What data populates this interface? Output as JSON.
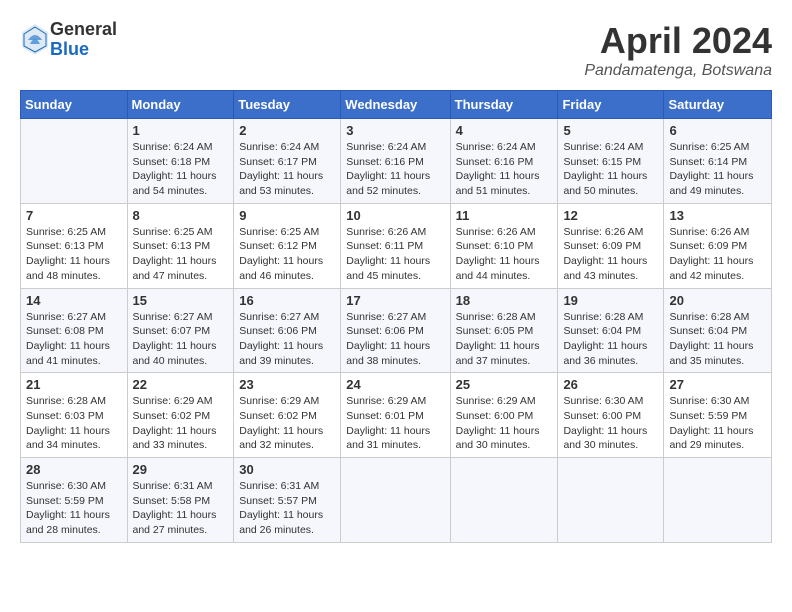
{
  "logo": {
    "general": "General",
    "blue": "Blue"
  },
  "title": "April 2024",
  "location": "Pandamatenga, Botswana",
  "days_header": [
    "Sunday",
    "Monday",
    "Tuesday",
    "Wednesday",
    "Thursday",
    "Friday",
    "Saturday"
  ],
  "weeks": [
    [
      {
        "day": "",
        "sunrise": "",
        "sunset": "",
        "daylight": ""
      },
      {
        "day": "1",
        "sunrise": "Sunrise: 6:24 AM",
        "sunset": "Sunset: 6:18 PM",
        "daylight": "Daylight: 11 hours and 54 minutes."
      },
      {
        "day": "2",
        "sunrise": "Sunrise: 6:24 AM",
        "sunset": "Sunset: 6:17 PM",
        "daylight": "Daylight: 11 hours and 53 minutes."
      },
      {
        "day": "3",
        "sunrise": "Sunrise: 6:24 AM",
        "sunset": "Sunset: 6:16 PM",
        "daylight": "Daylight: 11 hours and 52 minutes."
      },
      {
        "day": "4",
        "sunrise": "Sunrise: 6:24 AM",
        "sunset": "Sunset: 6:16 PM",
        "daylight": "Daylight: 11 hours and 51 minutes."
      },
      {
        "day": "5",
        "sunrise": "Sunrise: 6:24 AM",
        "sunset": "Sunset: 6:15 PM",
        "daylight": "Daylight: 11 hours and 50 minutes."
      },
      {
        "day": "6",
        "sunrise": "Sunrise: 6:25 AM",
        "sunset": "Sunset: 6:14 PM",
        "daylight": "Daylight: 11 hours and 49 minutes."
      }
    ],
    [
      {
        "day": "7",
        "sunrise": "Sunrise: 6:25 AM",
        "sunset": "Sunset: 6:13 PM",
        "daylight": "Daylight: 11 hours and 48 minutes."
      },
      {
        "day": "8",
        "sunrise": "Sunrise: 6:25 AM",
        "sunset": "Sunset: 6:13 PM",
        "daylight": "Daylight: 11 hours and 47 minutes."
      },
      {
        "day": "9",
        "sunrise": "Sunrise: 6:25 AM",
        "sunset": "Sunset: 6:12 PM",
        "daylight": "Daylight: 11 hours and 46 minutes."
      },
      {
        "day": "10",
        "sunrise": "Sunrise: 6:26 AM",
        "sunset": "Sunset: 6:11 PM",
        "daylight": "Daylight: 11 hours and 45 minutes."
      },
      {
        "day": "11",
        "sunrise": "Sunrise: 6:26 AM",
        "sunset": "Sunset: 6:10 PM",
        "daylight": "Daylight: 11 hours and 44 minutes."
      },
      {
        "day": "12",
        "sunrise": "Sunrise: 6:26 AM",
        "sunset": "Sunset: 6:09 PM",
        "daylight": "Daylight: 11 hours and 43 minutes."
      },
      {
        "day": "13",
        "sunrise": "Sunrise: 6:26 AM",
        "sunset": "Sunset: 6:09 PM",
        "daylight": "Daylight: 11 hours and 42 minutes."
      }
    ],
    [
      {
        "day": "14",
        "sunrise": "Sunrise: 6:27 AM",
        "sunset": "Sunset: 6:08 PM",
        "daylight": "Daylight: 11 hours and 41 minutes."
      },
      {
        "day": "15",
        "sunrise": "Sunrise: 6:27 AM",
        "sunset": "Sunset: 6:07 PM",
        "daylight": "Daylight: 11 hours and 40 minutes."
      },
      {
        "day": "16",
        "sunrise": "Sunrise: 6:27 AM",
        "sunset": "Sunset: 6:06 PM",
        "daylight": "Daylight: 11 hours and 39 minutes."
      },
      {
        "day": "17",
        "sunrise": "Sunrise: 6:27 AM",
        "sunset": "Sunset: 6:06 PM",
        "daylight": "Daylight: 11 hours and 38 minutes."
      },
      {
        "day": "18",
        "sunrise": "Sunrise: 6:28 AM",
        "sunset": "Sunset: 6:05 PM",
        "daylight": "Daylight: 11 hours and 37 minutes."
      },
      {
        "day": "19",
        "sunrise": "Sunrise: 6:28 AM",
        "sunset": "Sunset: 6:04 PM",
        "daylight": "Daylight: 11 hours and 36 minutes."
      },
      {
        "day": "20",
        "sunrise": "Sunrise: 6:28 AM",
        "sunset": "Sunset: 6:04 PM",
        "daylight": "Daylight: 11 hours and 35 minutes."
      }
    ],
    [
      {
        "day": "21",
        "sunrise": "Sunrise: 6:28 AM",
        "sunset": "Sunset: 6:03 PM",
        "daylight": "Daylight: 11 hours and 34 minutes."
      },
      {
        "day": "22",
        "sunrise": "Sunrise: 6:29 AM",
        "sunset": "Sunset: 6:02 PM",
        "daylight": "Daylight: 11 hours and 33 minutes."
      },
      {
        "day": "23",
        "sunrise": "Sunrise: 6:29 AM",
        "sunset": "Sunset: 6:02 PM",
        "daylight": "Daylight: 11 hours and 32 minutes."
      },
      {
        "day": "24",
        "sunrise": "Sunrise: 6:29 AM",
        "sunset": "Sunset: 6:01 PM",
        "daylight": "Daylight: 11 hours and 31 minutes."
      },
      {
        "day": "25",
        "sunrise": "Sunrise: 6:29 AM",
        "sunset": "Sunset: 6:00 PM",
        "daylight": "Daylight: 11 hours and 30 minutes."
      },
      {
        "day": "26",
        "sunrise": "Sunrise: 6:30 AM",
        "sunset": "Sunset: 6:00 PM",
        "daylight": "Daylight: 11 hours and 30 minutes."
      },
      {
        "day": "27",
        "sunrise": "Sunrise: 6:30 AM",
        "sunset": "Sunset: 5:59 PM",
        "daylight": "Daylight: 11 hours and 29 minutes."
      }
    ],
    [
      {
        "day": "28",
        "sunrise": "Sunrise: 6:30 AM",
        "sunset": "Sunset: 5:59 PM",
        "daylight": "Daylight: 11 hours and 28 minutes."
      },
      {
        "day": "29",
        "sunrise": "Sunrise: 6:31 AM",
        "sunset": "Sunset: 5:58 PM",
        "daylight": "Daylight: 11 hours and 27 minutes."
      },
      {
        "day": "30",
        "sunrise": "Sunrise: 6:31 AM",
        "sunset": "Sunset: 5:57 PM",
        "daylight": "Daylight: 11 hours and 26 minutes."
      },
      {
        "day": "",
        "sunrise": "",
        "sunset": "",
        "daylight": ""
      },
      {
        "day": "",
        "sunrise": "",
        "sunset": "",
        "daylight": ""
      },
      {
        "day": "",
        "sunrise": "",
        "sunset": "",
        "daylight": ""
      },
      {
        "day": "",
        "sunrise": "",
        "sunset": "",
        "daylight": ""
      }
    ]
  ]
}
